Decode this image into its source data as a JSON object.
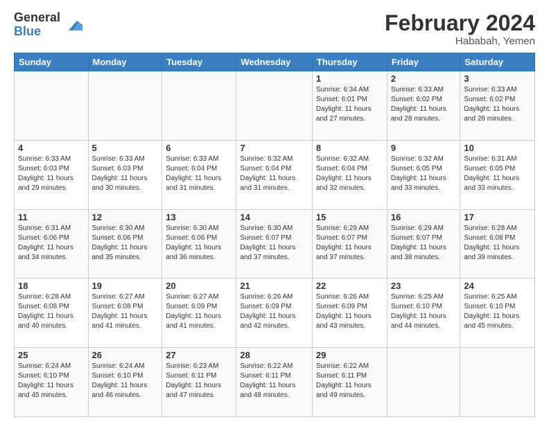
{
  "logo": {
    "general": "General",
    "blue": "Blue"
  },
  "title": "February 2024",
  "location": "Hababah, Yemen",
  "days_header": [
    "Sunday",
    "Monday",
    "Tuesday",
    "Wednesday",
    "Thursday",
    "Friday",
    "Saturday"
  ],
  "weeks": [
    [
      {
        "day": "",
        "info": ""
      },
      {
        "day": "",
        "info": ""
      },
      {
        "day": "",
        "info": ""
      },
      {
        "day": "",
        "info": ""
      },
      {
        "day": "1",
        "info": "Sunrise: 6:34 AM\nSunset: 6:01 PM\nDaylight: 11 hours\nand 27 minutes."
      },
      {
        "day": "2",
        "info": "Sunrise: 6:33 AM\nSunset: 6:02 PM\nDaylight: 11 hours\nand 28 minutes."
      },
      {
        "day": "3",
        "info": "Sunrise: 6:33 AM\nSunset: 6:02 PM\nDaylight: 11 hours\nand 28 minutes."
      }
    ],
    [
      {
        "day": "4",
        "info": "Sunrise: 6:33 AM\nSunset: 6:03 PM\nDaylight: 11 hours\nand 29 minutes."
      },
      {
        "day": "5",
        "info": "Sunrise: 6:33 AM\nSunset: 6:03 PM\nDaylight: 11 hours\nand 30 minutes."
      },
      {
        "day": "6",
        "info": "Sunrise: 6:33 AM\nSunset: 6:04 PM\nDaylight: 11 hours\nand 31 minutes."
      },
      {
        "day": "7",
        "info": "Sunrise: 6:32 AM\nSunset: 6:04 PM\nDaylight: 11 hours\nand 31 minutes."
      },
      {
        "day": "8",
        "info": "Sunrise: 6:32 AM\nSunset: 6:04 PM\nDaylight: 11 hours\nand 32 minutes."
      },
      {
        "day": "9",
        "info": "Sunrise: 6:32 AM\nSunset: 6:05 PM\nDaylight: 11 hours\nand 33 minutes."
      },
      {
        "day": "10",
        "info": "Sunrise: 6:31 AM\nSunset: 6:05 PM\nDaylight: 11 hours\nand 33 minutes."
      }
    ],
    [
      {
        "day": "11",
        "info": "Sunrise: 6:31 AM\nSunset: 6:06 PM\nDaylight: 11 hours\nand 34 minutes."
      },
      {
        "day": "12",
        "info": "Sunrise: 6:30 AM\nSunset: 6:06 PM\nDaylight: 11 hours\nand 35 minutes."
      },
      {
        "day": "13",
        "info": "Sunrise: 6:30 AM\nSunset: 6:06 PM\nDaylight: 11 hours\nand 36 minutes."
      },
      {
        "day": "14",
        "info": "Sunrise: 6:30 AM\nSunset: 6:07 PM\nDaylight: 11 hours\nand 37 minutes."
      },
      {
        "day": "15",
        "info": "Sunrise: 6:29 AM\nSunset: 6:07 PM\nDaylight: 11 hours\nand 37 minutes."
      },
      {
        "day": "16",
        "info": "Sunrise: 6:29 AM\nSunset: 6:07 PM\nDaylight: 11 hours\nand 38 minutes."
      },
      {
        "day": "17",
        "info": "Sunrise: 6:28 AM\nSunset: 6:08 PM\nDaylight: 11 hours\nand 39 minutes."
      }
    ],
    [
      {
        "day": "18",
        "info": "Sunrise: 6:28 AM\nSunset: 6:08 PM\nDaylight: 11 hours\nand 40 minutes."
      },
      {
        "day": "19",
        "info": "Sunrise: 6:27 AM\nSunset: 6:08 PM\nDaylight: 11 hours\nand 41 minutes."
      },
      {
        "day": "20",
        "info": "Sunrise: 6:27 AM\nSunset: 6:09 PM\nDaylight: 11 hours\nand 41 minutes."
      },
      {
        "day": "21",
        "info": "Sunrise: 6:26 AM\nSunset: 6:09 PM\nDaylight: 11 hours\nand 42 minutes."
      },
      {
        "day": "22",
        "info": "Sunrise: 6:26 AM\nSunset: 6:09 PM\nDaylight: 11 hours\nand 43 minutes."
      },
      {
        "day": "23",
        "info": "Sunrise: 6:25 AM\nSunset: 6:10 PM\nDaylight: 11 hours\nand 44 minutes."
      },
      {
        "day": "24",
        "info": "Sunrise: 6:25 AM\nSunset: 6:10 PM\nDaylight: 11 hours\nand 45 minutes."
      }
    ],
    [
      {
        "day": "25",
        "info": "Sunrise: 6:24 AM\nSunset: 6:10 PM\nDaylight: 11 hours\nand 45 minutes."
      },
      {
        "day": "26",
        "info": "Sunrise: 6:24 AM\nSunset: 6:10 PM\nDaylight: 11 hours\nand 46 minutes."
      },
      {
        "day": "27",
        "info": "Sunrise: 6:23 AM\nSunset: 6:11 PM\nDaylight: 11 hours\nand 47 minutes."
      },
      {
        "day": "28",
        "info": "Sunrise: 6:22 AM\nSunset: 6:11 PM\nDaylight: 11 hours\nand 48 minutes."
      },
      {
        "day": "29",
        "info": "Sunrise: 6:22 AM\nSunset: 6:11 PM\nDaylight: 11 hours\nand 49 minutes."
      },
      {
        "day": "",
        "info": ""
      },
      {
        "day": "",
        "info": ""
      }
    ]
  ]
}
